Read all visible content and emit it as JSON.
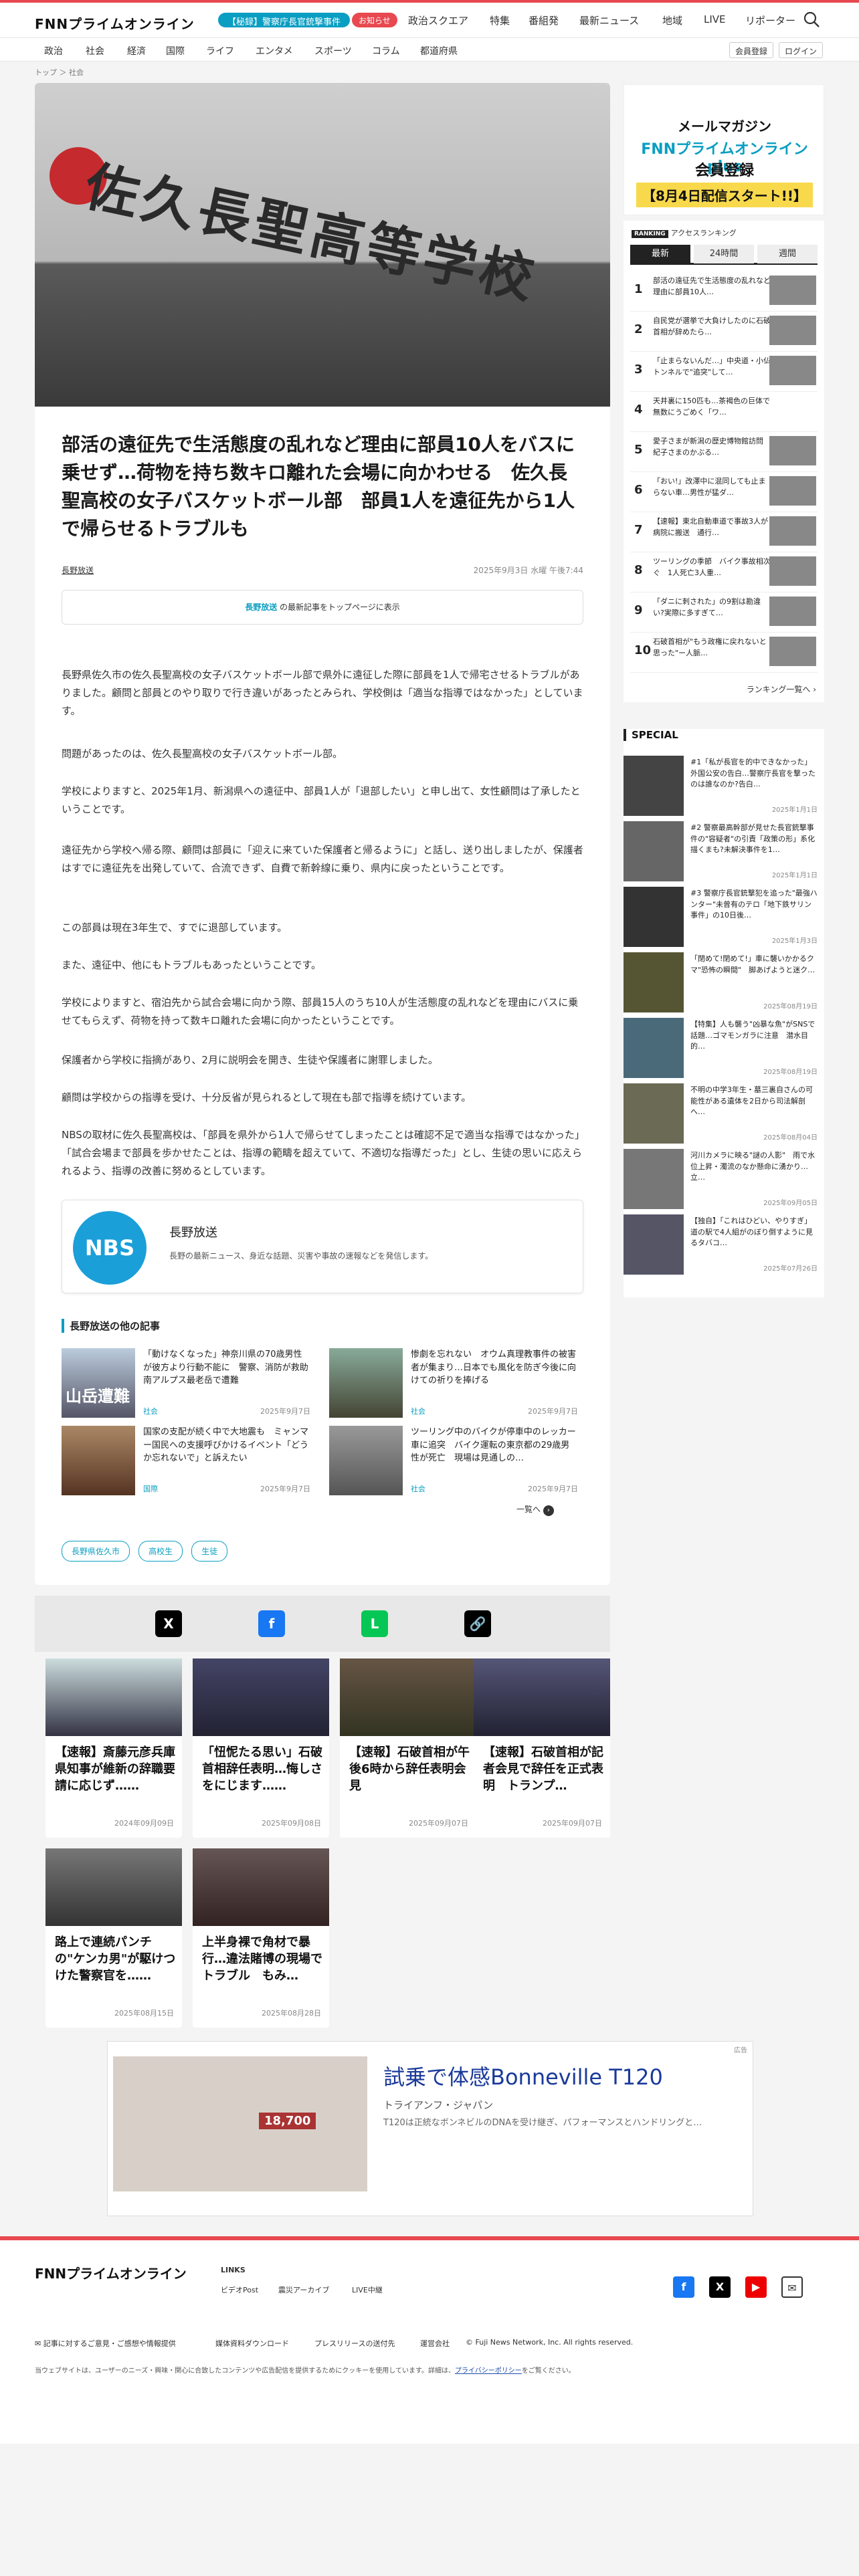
{
  "header": {
    "logo": "FNNプライムオンライン",
    "pill": "【秘録】警察庁長官銃撃事件",
    "badge": "お知らせ",
    "nav": [
      "政治スクエア",
      "特集",
      "番組発",
      "最新ニュース",
      "地域",
      "LIVE",
      "リポーター"
    ]
  },
  "subnav": {
    "items": [
      "政治",
      "社会",
      "経済",
      "国際",
      "ライフ",
      "エンタメ",
      "スポーツ",
      "コラム",
      "都道府県"
    ],
    "member": "会員登録",
    "login": "ログイン"
  },
  "breadcrumb": {
    "home": "トップ",
    "current": "社会"
  },
  "hero": {
    "sign": "佐久長聖高等学校"
  },
  "article": {
    "title": "部活の遠征先で生活態度の乱れなど理由に部員10人をバスに乗せず…荷物を持ち数キロ離れた会場に向かわせる　佐久長聖高校の女子バスケットボール部　部員1人を遠征先から1人で帰らせるトラブルも",
    "source": "長野放送",
    "date": "2025年9月3日 水曜 午後7:44",
    "follow_source": "長野放送",
    "follow_text": " の最新記事をトップページに表示",
    "paragraphs": [
      "長野県佐久市の佐久長聖高校の女子バスケットボール部で県外に遠征した際に部員を1人で帰宅させるトラブルがありました。顧問と部員とのやり取りで行き違いがあったとみられ、学校側は「適当な指導ではなかった」としています。",
      "問題があったのは、佐久長聖高校の女子バスケットボール部。",
      "学校によりますと、2025年1月、新潟県への遠征中、部員1人が「退部したい」と申し出て、女性顧問は了承したということです。",
      "遠征先から学校へ帰る際、顧問は部員に「迎えに来ていた保護者と帰るように」と話し、送り出しましたが、保護者はすでに遠征先を出発していて、合流できず、自費で新幹線に乗り、県内に戻ったということです。",
      "この部員は現在3年生で、すでに退部しています。",
      "また、遠征中、他にもトラブルもあったということです。",
      "学校によりますと、宿泊先から試合会場に向かう際、部員15人のうち10人が生活態度の乱れなどを理由にバスに乗せてもらえず、荷物を持って数キロ離れた会場に向かったということです。",
      "保護者から学校に指摘があり、2月に説明会を開き、生徒や保護者に謝罪しました。",
      "顧問は学校からの指導を受け、十分反省が見られるとして現在も部で指導を続けています。",
      "NBSの取材に佐久長聖高校は、「部員を県外から1人で帰らせてしまったことは確認不足で適当な指導ではなかった」「試合会場まで部員を歩かせたことは、指導の範疇を超えていて、不適切な指導だった」とし、生徒の思いに応えられるよう、指導の改善に努めるとしています。"
    ]
  },
  "source_card": {
    "logo": "NBS",
    "name": "長野放送",
    "desc": "長野の最新ニュース、身近な話題、災害や事故の速報などを発信します。"
  },
  "related": {
    "heading": "長野放送の他の記事",
    "items": [
      {
        "title": "「動けなくなった」神奈川県の70歳男性が彼方より行動不能に　警察、消防が救助　南アルプス最老岳で遭難",
        "cat": "社会",
        "date": "2025年9月7日",
        "thumb": "山岳遭難"
      },
      {
        "title": "惨劇を忘れない　オウム真理教事件の被害者が集まり…日本でも風化を防ぎ今後に向けての祈りを捧げる",
        "cat": "社会",
        "date": "2025年9月7日",
        "thumb": ""
      },
      {
        "title": "国家の支配が続く中で大地震も　ミャンマー国民への支援呼びかけるイベント「どうか忘れないで」と訴えたい",
        "cat": "国際",
        "date": "2025年9月7日",
        "thumb": ""
      },
      {
        "title": "ツーリング中のバイクが停車中のレッカー車に追突　バイク運転の東京都の29歳男性が死亡　現場は見通しの…",
        "cat": "社会",
        "date": "2025年9月7日",
        "thumb": ""
      }
    ],
    "more": "一覧へ"
  },
  "tags": [
    "長野県佐久市",
    "高校生",
    "生徒"
  ],
  "share": [
    "X",
    "f",
    "L",
    "🔗"
  ],
  "videos": [
    {
      "title": "【速報】斎藤元彦兵庫県知事が維新の辞職要請に応じず……",
      "date": "2024年09月09日"
    },
    {
      "title": "「忸怩たる思い」石破首相辞任表明…悔しさをにじます……",
      "date": "2025年09月08日"
    },
    {
      "title": "【速報】石破首相が午後6時から辞任表明会見",
      "date": "2025年09月07日"
    },
    {
      "title": "【速報】石破首相が記者会見で辞任を正式表明　トランプ…",
      "date": "2025年09月07日"
    },
    {
      "title": "路上で連続パンチの\"ケンカ男\"が駆けつけた警察官を……",
      "date": "2025年08月15日"
    },
    {
      "title": "上半身裸で角材で暴行…違法賭博の現場でトラブル　もみ…",
      "date": "2025年08月28日"
    }
  ],
  "ad": {
    "label": "広告",
    "title": "試乗で体感Bonneville T120",
    "sponsor": "トライアンフ・ジャパン",
    "text": "T120は正統なボンネビルのDNAを受け継ぎ、パフォーマンスとハンドリングと…",
    "price": "18,700"
  },
  "footer": {
    "logo": "FNNプライムオンライン",
    "links_heading": "LINKS",
    "links": [
      "ビデオPost",
      "震災アーカイブ",
      "LIVE中継"
    ],
    "bottom": [
      "記事に対するご意見・ご感想や情報提供",
      "媒体資料ダウンロード",
      "プレスリリースの送付先",
      "運営会社",
      "© Fuji News Network, Inc. All rights reserved."
    ],
    "note": "当ウェブサイトは、ユーザーのニーズ・興味・関心に合致したコンテンツや広告配信を提供するためにクッキーを使用しています。詳細は、",
    "privacy": "プライバシーポリシー",
    "note_end": "をご覧ください。"
  },
  "promo": {
    "line1": "メールマガジン",
    "line2": "FNNプライムオンラインplus",
    "line3": "会員登録",
    "line4": "【8月4日配信スタート!!】"
  },
  "ranking": {
    "badge": "RANKING",
    "heading": "アクセスランキング",
    "tabs": [
      "最新",
      "24時間",
      "週間"
    ],
    "items": [
      "部活の遠征先で生活態度の乱れなど理由に部員10人…",
      "自民党が選挙で大負けしたのに石破首相が辞めたら…",
      "「止まらないんだ…」中央道・小仏トンネルで\"追突\"して…",
      "天井裏に150匹も…茶褐色の巨体で無数にうごめく「ワ…",
      "愛子さまが新潟の歴史博物館訪問　紀子さまのかぶる…",
      "「おい!」改澤中に混同しても止まらない車…男性が猛ダ…",
      "【速報】東北自動車道で事故3人が病院に搬送　通行…",
      "ツーリングの季節　バイク事故相次ぐ　1人死亡3人重…",
      "「ダニに刺された」の9割は勘違い?実際に多すぎて…",
      "石破首相が\"もう政権に戻れないと思った\"ー人脈…"
    ],
    "more": "ランキング一覧へ"
  },
  "special": {
    "heading": "SPECIAL",
    "items": [
      {
        "title": "#1「私が長官を的中できなかった」外国公安の告白…警察庁長官を撃ったのは誰なのか?告白…",
        "date": "2025年1月1日"
      },
      {
        "title": "#2 警察最高幹部が見せた長官銃撃事件の\"容疑者\"の引責「政策の形」系化描くまも?未解決事件を1…",
        "date": "2025年1月1日"
      },
      {
        "title": "#3 警察庁長官銃撃犯を追った\"最強ハンター\"未曾有のテロ「地下鉄サリン事件」の10日後…",
        "date": "2025年1月3日"
      },
      {
        "title": "「閉めて!閉めて!」車に襲いかかるクマ\"恐怖の瞬間\"　脚あげようと迷ク…",
        "date": "2025年08月19日"
      },
      {
        "title": "【特集】人も襲う\"凶暴な魚\"がSNSで話題…ゴマモンガラに注意　潜水目的…",
        "date": "2025年08月19日"
      },
      {
        "title": "不明の中学3年生・墓三裏自さんの可能性がある遺体を2日から司法解剖へ…",
        "date": "2025年08月04日"
      },
      {
        "title": "河川カメラに映る\"謎の人影\"　雨で水位上昇・濁流のなか懸命に湧かり…立…",
        "date": "2025年09月05日"
      },
      {
        "title": "【独自】「これはひどい、やりすぎ」道の駅で4人組がのぼり倒すように見るタバコ…",
        "date": "2025年07月26日"
      }
    ]
  }
}
